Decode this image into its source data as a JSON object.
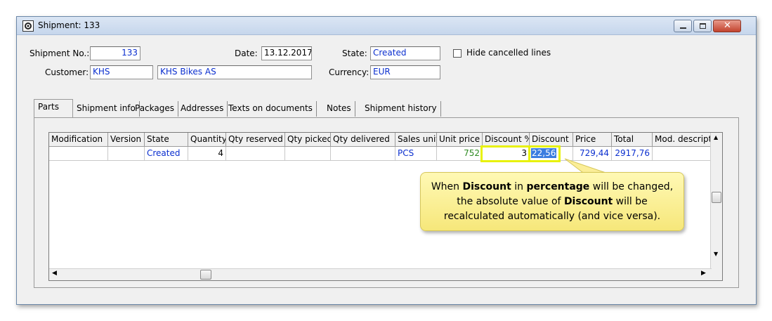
{
  "window": {
    "title": "Shipment: 133"
  },
  "form": {
    "shipment_no_label": "Shipment No.:",
    "shipment_no": "133",
    "date_label": "Date:",
    "date": "13.12.2017",
    "state_label": "State:",
    "state": "Created",
    "hide_cancelled_label": "Hide cancelled lines",
    "customer_label": "Customer:",
    "customer_code": "KHS",
    "customer_name": "KHS Bikes AS",
    "currency_label": "Currency:",
    "currency": "EUR"
  },
  "tabs": [
    "Parts",
    "Shipment info",
    "Packages",
    "Addresses",
    "Texts on documents",
    "Notes",
    "Shipment history"
  ],
  "grid": {
    "columns": [
      "Modification",
      "Version",
      "State",
      "Quantity",
      "Qty reserved",
      "Qty picked",
      "Qty delivered",
      "Sales unit",
      "Unit price",
      "Discount %",
      "Discount",
      "Price",
      "Total",
      "Mod. descriptio"
    ],
    "row": {
      "modification": "",
      "version": "",
      "state": "Created",
      "quantity": "4",
      "qty_reserved": "",
      "qty_picked": "",
      "qty_delivered": "",
      "sales_unit": "PCS",
      "unit_price": "752",
      "discount_pct": "3",
      "discount": "22,56",
      "price": "729,44",
      "total": "2917,76",
      "mod_description": ""
    }
  },
  "callout": {
    "t1": "When ",
    "b1": "Discount",
    "t2": " in ",
    "b2": "percentage",
    "t3": " will be changed, the absolute value of ",
    "b3": "Discount",
    "t4": " will be recalculated automatically (and vice versa)."
  },
  "colors": {
    "accent_blue": "#0b2fcf",
    "green_value": "#2e8b22",
    "callout_fill": "#fff3a0",
    "highlight": "#e8f20a"
  }
}
